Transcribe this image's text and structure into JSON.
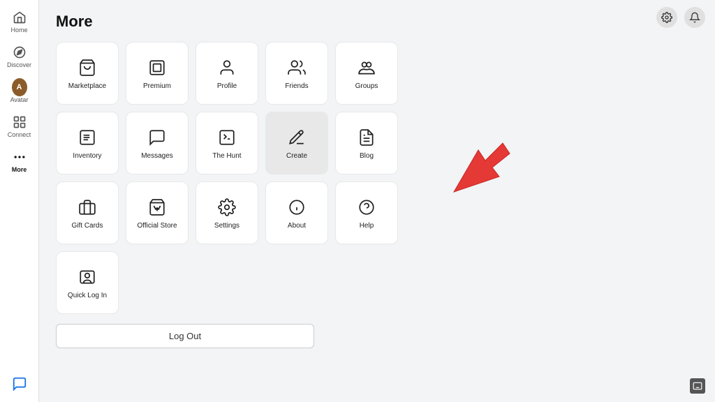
{
  "page": {
    "title": "More"
  },
  "sidebar": {
    "items": [
      {
        "id": "home",
        "label": "Home",
        "icon": "home"
      },
      {
        "id": "discover",
        "label": "Discover",
        "icon": "compass"
      },
      {
        "id": "avatar",
        "label": "Avatar",
        "icon": "avatar",
        "isAvatar": true
      },
      {
        "id": "connect",
        "label": "Connect",
        "icon": "grid"
      },
      {
        "id": "more",
        "label": "More",
        "icon": "more",
        "active": true
      }
    ]
  },
  "grid": {
    "items": [
      {
        "id": "marketplace",
        "label": "Marketplace",
        "icon": "bag"
      },
      {
        "id": "premium",
        "label": "Premium",
        "icon": "premium"
      },
      {
        "id": "profile",
        "label": "Profile",
        "icon": "person"
      },
      {
        "id": "friends",
        "label": "Friends",
        "icon": "friends"
      },
      {
        "id": "groups",
        "label": "Groups",
        "icon": "groups"
      },
      {
        "id": "inventory",
        "label": "Inventory",
        "icon": "inventory"
      },
      {
        "id": "messages",
        "label": "Messages",
        "icon": "messages"
      },
      {
        "id": "thehunt",
        "label": "The Hunt",
        "icon": "hunt"
      },
      {
        "id": "create",
        "label": "Create",
        "icon": "create",
        "active": true
      },
      {
        "id": "blog",
        "label": "Blog",
        "icon": "blog"
      },
      {
        "id": "giftcards",
        "label": "Gift Cards",
        "icon": "giftcard"
      },
      {
        "id": "officialstore",
        "label": "Official Store",
        "icon": "store"
      },
      {
        "id": "settings",
        "label": "Settings",
        "icon": "settings"
      },
      {
        "id": "about",
        "label": "About",
        "icon": "about"
      },
      {
        "id": "help",
        "label": "Help",
        "icon": "help"
      },
      {
        "id": "quicklogin",
        "label": "Quick Log In",
        "icon": "quicklogin"
      }
    ],
    "logout_label": "Log Out"
  },
  "topbar": {
    "settings_icon": "settings",
    "bell_icon": "bell"
  }
}
